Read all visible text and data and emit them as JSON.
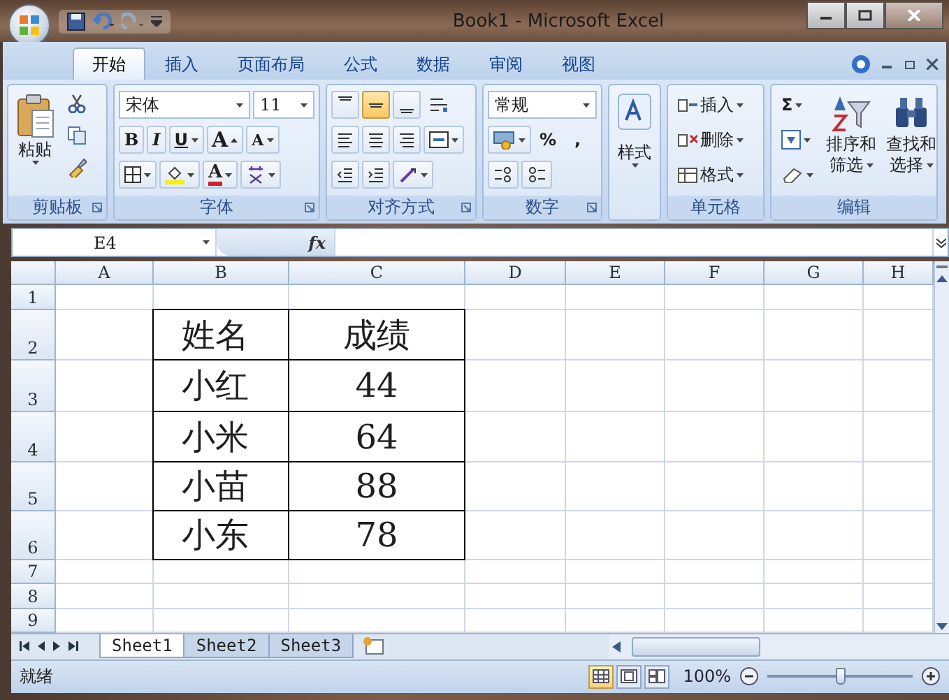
{
  "window": {
    "title": "Book1 - Microsoft Excel"
  },
  "ribbon_tabs": [
    {
      "label": "开始",
      "selected": true
    },
    {
      "label": "插入",
      "selected": false
    },
    {
      "label": "页面布局",
      "selected": false
    },
    {
      "label": "公式",
      "selected": false
    },
    {
      "label": "数据",
      "selected": false
    },
    {
      "label": "审阅",
      "selected": false
    },
    {
      "label": "视图",
      "selected": false
    }
  ],
  "ribbon_groups": [
    {
      "kind": "clipboard",
      "label": "剪贴板",
      "paste": "粘贴"
    },
    {
      "kind": "font",
      "label": "字体",
      "font_name": "宋体",
      "font_size": "11",
      "bold": "B",
      "italic": "I",
      "underline": "U",
      "grow": "A",
      "shrink": "A",
      "font_color": "A"
    },
    {
      "kind": "alignment",
      "label": "对齐方式",
      "vertical_align": [
        {
          "kind": "top",
          "selected": false
        },
        {
          "kind": "middle",
          "selected": true
        },
        {
          "kind": "bottom",
          "selected": false
        }
      ]
    },
    {
      "kind": "number",
      "label": "数字",
      "format": "常规",
      "percent": "%",
      "comma": ","
    },
    {
      "kind": "styles",
      "button": "样式"
    },
    {
      "kind": "cells",
      "label": "单元格",
      "buttons": [
        "插入",
        "删除",
        "格式"
      ]
    },
    {
      "kind": "editing",
      "label": "编辑",
      "sum": "Σ",
      "sort": [
        "排序和",
        "筛选"
      ],
      "find": [
        "查找和",
        "选择"
      ]
    }
  ],
  "formula_bar": {
    "name_box": "E4",
    "fx": "fx"
  },
  "sheet": {
    "columns": [
      "A",
      "B",
      "C",
      "D",
      "E",
      "F",
      "G",
      "H"
    ],
    "row_headers": [
      "1",
      "2",
      "3",
      "4",
      "5",
      "6",
      "7",
      "8",
      "9"
    ],
    "data_table": [
      [
        "姓名",
        "成绩"
      ],
      [
        "小红",
        "44"
      ],
      [
        "小米",
        "64"
      ],
      [
        "小苗",
        "88"
      ],
      [
        "小东",
        "78"
      ]
    ]
  },
  "sheet_tabs": [
    {
      "label": "Sheet1",
      "selected": true
    },
    {
      "label": "Sheet2",
      "selected": false
    },
    {
      "label": "Sheet3",
      "selected": false
    }
  ],
  "status_bar": {
    "status": "就绪",
    "views": [
      {
        "kind": "normal",
        "selected": true
      },
      {
        "kind": "page_layout",
        "selected": false
      },
      {
        "kind": "page_break",
        "selected": false
      }
    ],
    "zoom": "100%",
    "zoom_slider": {
      "level": 0.5
    }
  }
}
